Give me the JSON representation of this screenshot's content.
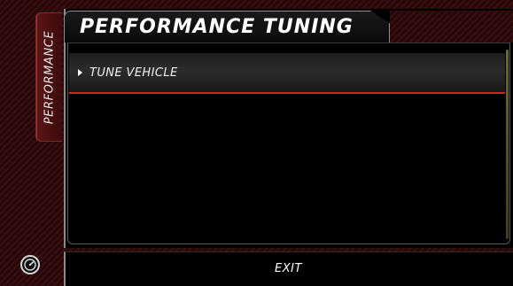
{
  "sidebar": {
    "tab_label": "PERFORMANCE",
    "bottom_icon": "gauge-icon"
  },
  "header": {
    "title": "PERFORMANCE TUNING"
  },
  "menu": {
    "items": [
      {
        "label": "TUNE VEHICLE",
        "icon": "arrow-right-icon",
        "selected": true
      }
    ]
  },
  "footer": {
    "exit_label": "EXIT"
  },
  "colors": {
    "accent_red": "#d2231f",
    "scrollbar": "#6b6a28",
    "background_stripe": "#3a0f10"
  }
}
